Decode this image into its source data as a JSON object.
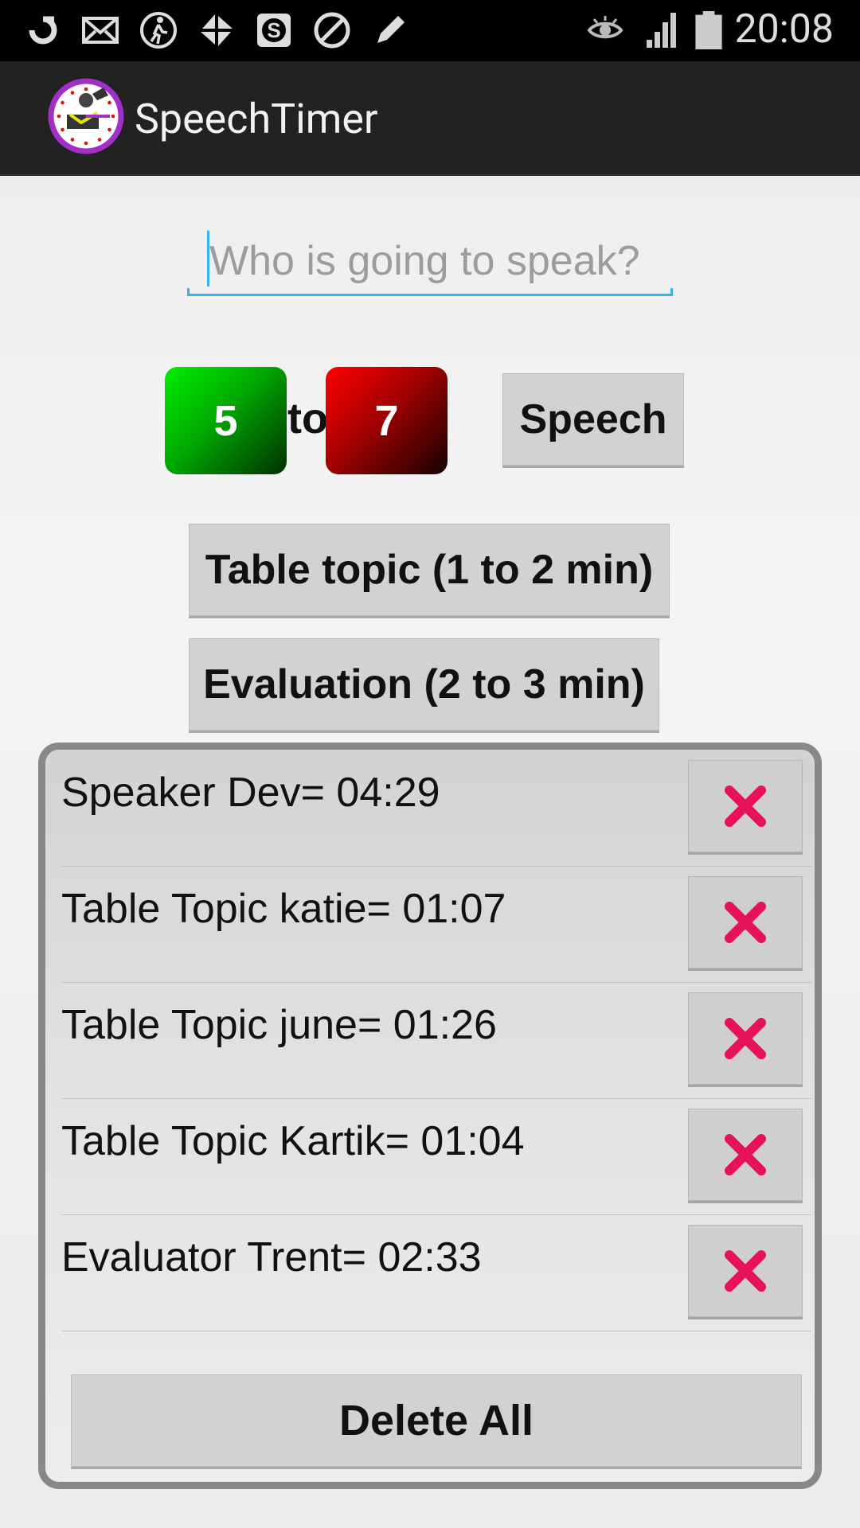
{
  "status_bar": {
    "time": "20:08",
    "left_icons": [
      "sync-icon",
      "mail-icon",
      "walker-icon",
      "pinwheel-icon",
      "s-app-icon",
      "blocked-icon",
      "pencil-icon"
    ],
    "right_icons": [
      "eye-icon",
      "signal-icon",
      "battery-icon"
    ]
  },
  "action_bar": {
    "title": "SpeechTimer"
  },
  "speaker_input": {
    "placeholder": "Who is going to speak?",
    "value": ""
  },
  "time_range": {
    "min": "5",
    "to_label": "to",
    "max": "7"
  },
  "buttons": {
    "speech": "Speech",
    "table_topic": "Table topic (1 to 2 min)",
    "evaluation": "Evaluation (2 to 3 min)",
    "delete_all": "Delete All"
  },
  "records": [
    {
      "label": "Speaker Dev= 04:29"
    },
    {
      "label": "Table Topic katie= 01:07"
    },
    {
      "label": "Table Topic june= 01:26"
    },
    {
      "label": "Table Topic Kartik= 01:04"
    },
    {
      "label": "Evaluator Trent= 02:33"
    }
  ],
  "colors": {
    "accent": "#33b5e5",
    "delete_x": "#e8125c",
    "min_box": "#00c000",
    "max_box": "#c00000"
  }
}
